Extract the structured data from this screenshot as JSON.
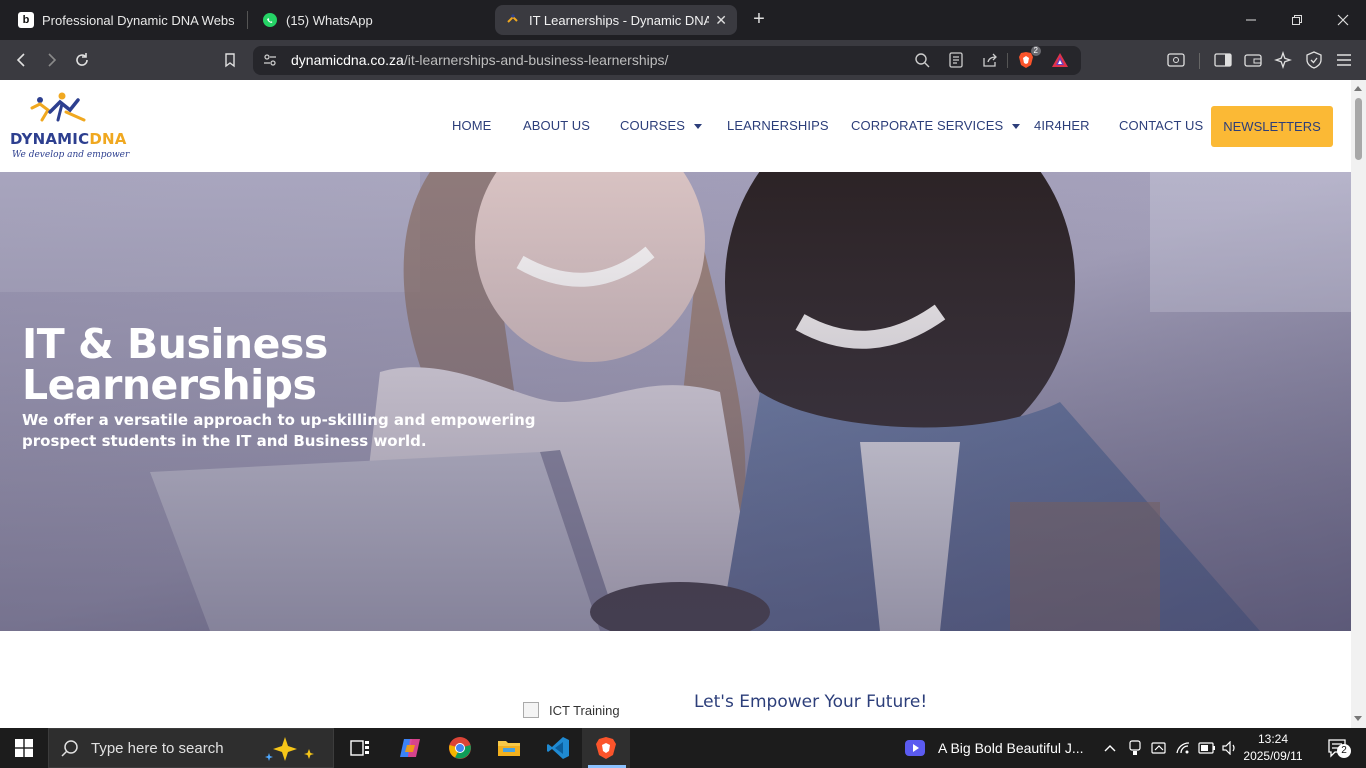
{
  "browser": {
    "tabs": [
      {
        "title": "Professional Dynamic DNA Website",
        "icon": "b-logo-icon",
        "active": false
      },
      {
        "title": "(15) WhatsApp",
        "icon": "whatsapp-icon",
        "active": false
      },
      {
        "title": "IT Learnerships - Dynamic DNA I",
        "icon": "dynamicdna-icon",
        "active": true
      }
    ],
    "address": {
      "host": "dynamicdna.co.za",
      "path": "/it-learnerships-and-business-learnerships/"
    },
    "shields_count": "2",
    "colors": {
      "tab_bg": "#1f1f23",
      "toolbar_bg": "#3a3a40",
      "brave_orange": "#fb542b"
    }
  },
  "site": {
    "logo": {
      "word_1": "DYNAMIC",
      "word_2": "DNA",
      "tagline": "We develop and empower"
    },
    "nav": [
      {
        "label": "HOME",
        "has_dropdown": false
      },
      {
        "label": "ABOUT US",
        "has_dropdown": false
      },
      {
        "label": "COURSES",
        "has_dropdown": true
      },
      {
        "label": "LEARNERSHIPS",
        "has_dropdown": false
      },
      {
        "label": "CORPORATE SERVICES",
        "has_dropdown": true
      },
      {
        "label": "4IR4HER",
        "has_dropdown": false
      },
      {
        "label": "CONTACT US",
        "has_dropdown": false
      }
    ],
    "newsletters_label": "NEWSLETTERS",
    "hero": {
      "title_line_1": "IT & Business",
      "title_line_2": "Learnerships",
      "subtitle": "We offer a versatile approach to up-skilling and empowering prospect students in the IT and Business world."
    },
    "section": {
      "image_alt": "ICT Training",
      "heading": "Let's Empower Your Future!"
    },
    "colors": {
      "navy": "#2c3e7a",
      "accent_yellow": "#fbb935",
      "hero_tint": "#8d8aa6"
    }
  },
  "taskbar": {
    "search_placeholder": "Type here to search",
    "media_title": "A Big Bold Beautiful J...",
    "time": "13:24",
    "date": "2025/09/11",
    "notification_count": "2",
    "pinned": [
      "task-view-icon",
      "copilot-icon",
      "chrome-icon",
      "file-explorer-icon",
      "vscode-icon",
      "brave-icon"
    ]
  }
}
